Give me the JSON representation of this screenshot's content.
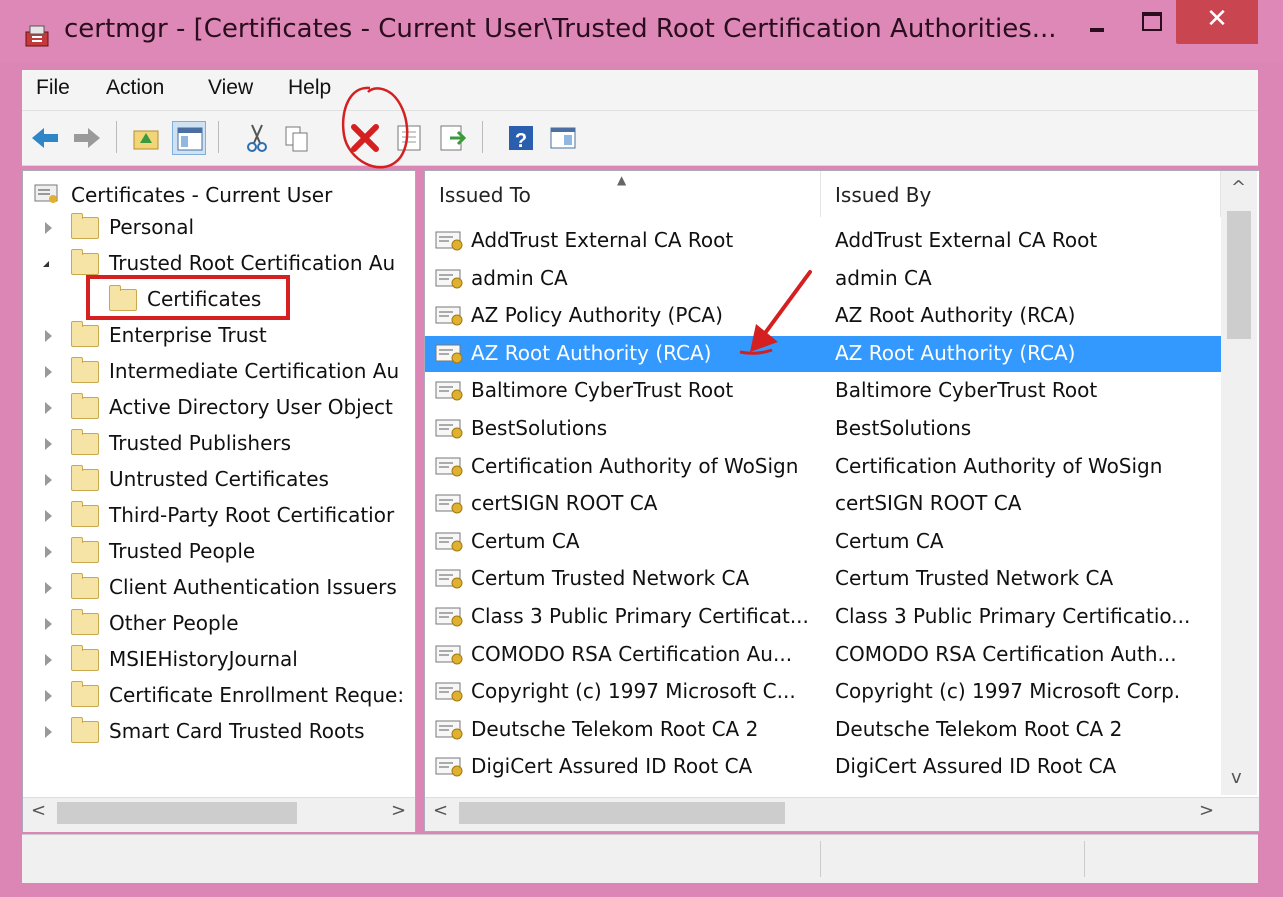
{
  "window": {
    "title": "certmgr - [Certificates - Current User\\Trusted Root Certification Authorities...",
    "minimize_icon": "minimize-icon",
    "maximize_icon": "maximize-icon",
    "close_label": "✕"
  },
  "menu": {
    "items": [
      "File",
      "Action",
      "View",
      "Help"
    ]
  },
  "toolbar": {
    "buttons": [
      "back-icon",
      "forward-icon",
      "up-folder-icon",
      "show-hide-tree-icon",
      "cut-icon",
      "copy-icon",
      "delete-icon",
      "properties-icon",
      "export-icon",
      "help-icon",
      "view-icon"
    ]
  },
  "tree": {
    "root": "Certificates - Current User",
    "items": [
      {
        "label": "Personal",
        "expanded": false
      },
      {
        "label": "Trusted Root Certification Au",
        "expanded": true
      },
      {
        "label": "Certificates",
        "child": true,
        "selected": true
      },
      {
        "label": "Enterprise Trust",
        "expanded": false
      },
      {
        "label": "Intermediate Certification Au",
        "expanded": false
      },
      {
        "label": "Active Directory User Object",
        "expanded": false
      },
      {
        "label": "Trusted Publishers",
        "expanded": false
      },
      {
        "label": "Untrusted Certificates",
        "expanded": false
      },
      {
        "label": "Third-Party Root Certificatior",
        "expanded": false
      },
      {
        "label": "Trusted People",
        "expanded": false
      },
      {
        "label": "Client Authentication Issuers",
        "expanded": false
      },
      {
        "label": "Other People",
        "expanded": false
      },
      {
        "label": "MSIEHistoryJournal",
        "expanded": false
      },
      {
        "label": "Certificate Enrollment Reque:",
        "expanded": false
      },
      {
        "label": "Smart Card Trusted Roots",
        "expanded": false
      }
    ],
    "scroll_left": "<",
    "scroll_right": ">"
  },
  "list": {
    "columns": [
      "Issued To",
      "Issued By"
    ],
    "selected_index": 3,
    "rows": [
      {
        "issued_to": "AddTrust External CA Root",
        "issued_by": "AddTrust External CA Root"
      },
      {
        "issued_to": "admin CA",
        "issued_by": "admin CA"
      },
      {
        "issued_to": "AZ Policy Authority (PCA)",
        "issued_by": "AZ Root Authority (RCA)"
      },
      {
        "issued_to": "AZ Root Authority (RCA)",
        "issued_by": "AZ Root Authority (RCA)"
      },
      {
        "issued_to": "Baltimore CyberTrust Root",
        "issued_by": "Baltimore CyberTrust Root"
      },
      {
        "issued_to": "BestSolutions",
        "issued_by": "BestSolutions"
      },
      {
        "issued_to": "Certification Authority of WoSign",
        "issued_by": "Certification Authority of WoSign"
      },
      {
        "issued_to": "certSIGN ROOT CA",
        "issued_by": "certSIGN ROOT CA"
      },
      {
        "issued_to": "Certum CA",
        "issued_by": "Certum CA"
      },
      {
        "issued_to": "Certum Trusted Network CA",
        "issued_by": "Certum Trusted Network CA"
      },
      {
        "issued_to": "Class 3 Public Primary Certificat...",
        "issued_by": "Class 3 Public Primary Certificatio..."
      },
      {
        "issued_to": "COMODO RSA Certification Au...",
        "issued_by": "COMODO RSA Certification Auth..."
      },
      {
        "issued_to": "Copyright (c) 1997 Microsoft C...",
        "issued_by": "Copyright (c) 1997 Microsoft Corp."
      },
      {
        "issued_to": "Deutsche Telekom Root CA 2",
        "issued_by": "Deutsche Telekom Root CA 2"
      },
      {
        "issued_to": "DigiCert Assured ID Root CA",
        "issued_by": "DigiCert Assured ID Root CA"
      }
    ],
    "scroll_up": "^",
    "scroll_down": "v",
    "scroll_left": "<",
    "scroll_right": ">"
  },
  "colors": {
    "selection": "#3399ff",
    "annotation_red": "#d42020",
    "title_bar": "#de88b7"
  }
}
